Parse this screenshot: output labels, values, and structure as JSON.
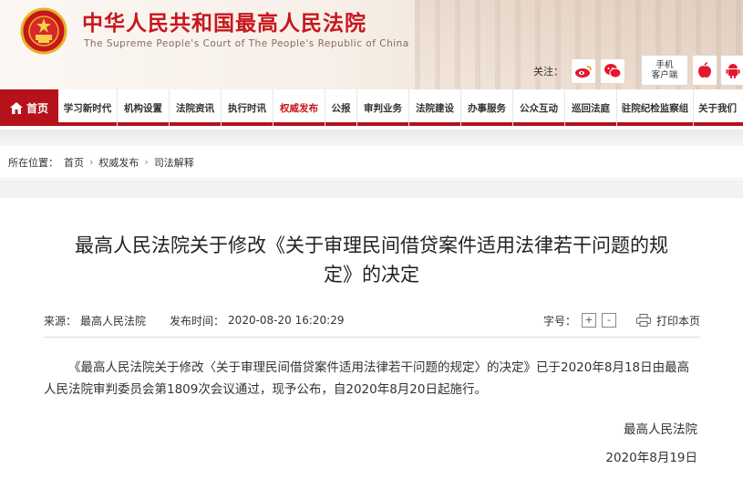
{
  "header": {
    "title": "中华人民共和国最高人民法院",
    "subtitle": "The Supreme People's Court of The People's Republic of China",
    "follow_label": "关注：",
    "app_label_line1": "手机",
    "app_label_line2": "客户端",
    "icons": [
      "weibo-icon",
      "wechat-icon",
      "apple-icon",
      "android-icon"
    ]
  },
  "nav": {
    "home": "首页",
    "items": [
      "学习新时代",
      "机构设置",
      "法院资讯",
      "执行时讯",
      "权威发布",
      "公报",
      "审判业务",
      "法院建设",
      "办事服务",
      "公众互动",
      "巡回法庭",
      "驻院纪检监察组",
      "关于我们"
    ],
    "active_index": 4,
    "accent_color": "#b5121b"
  },
  "breadcrumb": {
    "label": "所在位置：",
    "items": [
      "首页",
      "权威发布",
      "司法解释"
    ]
  },
  "article": {
    "title": "最高人民法院关于修改《关于审理民间借贷案件适用法律若干问题的规定》的决定",
    "source_label": "来源：",
    "source": "最高人民法院",
    "date_label": "发布时间：",
    "date": "2020-08-20 16:20:29",
    "font_size_label": "字号：",
    "font_increase": "+",
    "font_decrease": "-",
    "print_label": "打印本页",
    "body": "《最高人民法院关于修改〈关于审理民间借贷案件适用法律若干问题的规定〉的决定》已于2020年8月18日由最高人民法院审判委员会第1809次会议通过，现予公布，自2020年8月20日起施行。",
    "signature": "最高人民法院",
    "sign_date": "2020年8月19日"
  }
}
